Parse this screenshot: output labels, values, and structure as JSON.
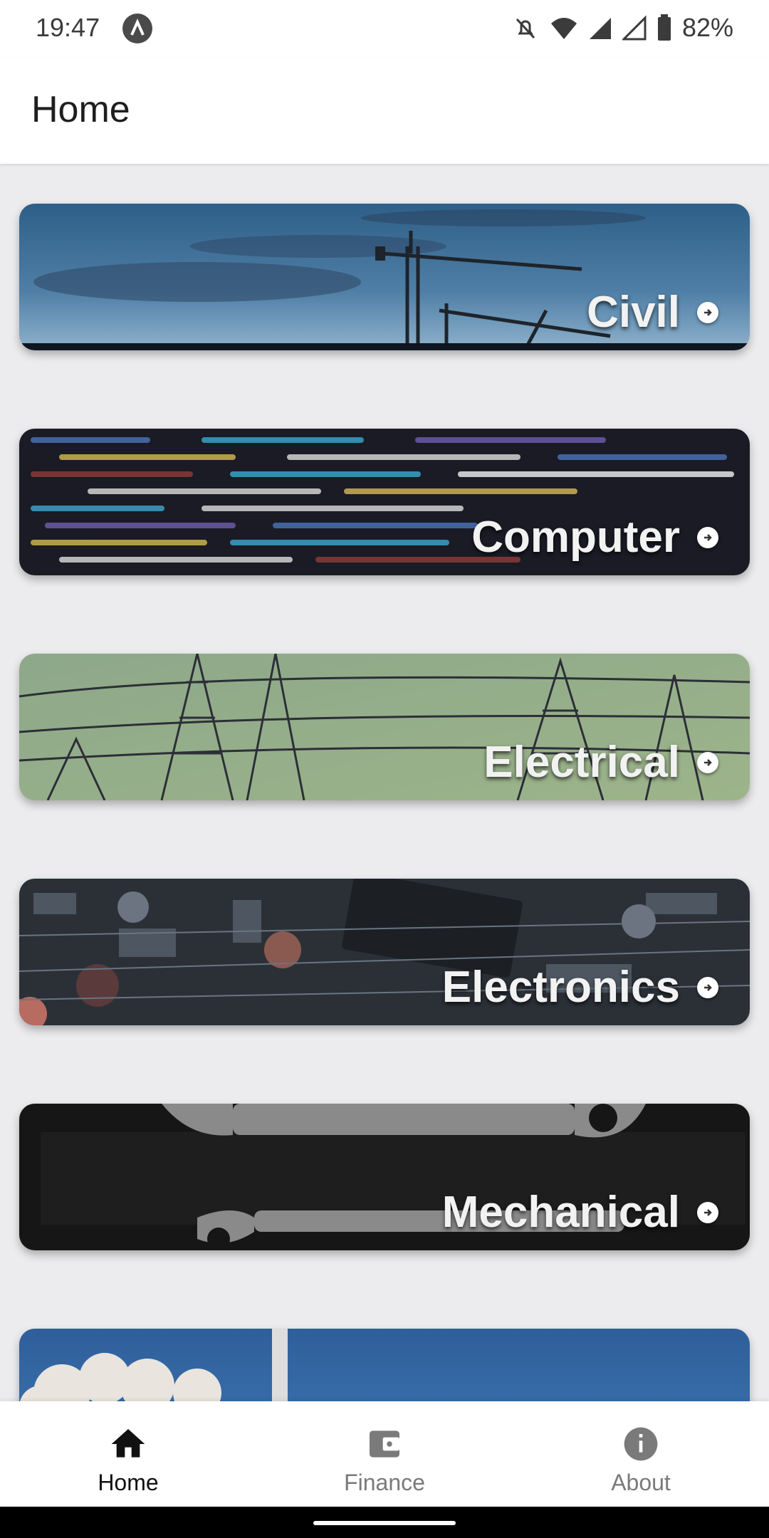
{
  "status_bar": {
    "time": "19:47",
    "battery": "82%"
  },
  "app_bar": {
    "title": "Home"
  },
  "cards": [
    {
      "label": "Civil"
    },
    {
      "label": "Computer"
    },
    {
      "label": "Electrical"
    },
    {
      "label": "Electronics"
    },
    {
      "label": "Mechanical"
    }
  ],
  "bottom_nav": {
    "home": "Home",
    "finance": "Finance",
    "about": "About",
    "active": "Home"
  },
  "colors": {
    "accent": "#111111",
    "inactive": "#7a7a7a",
    "background": "#ececee"
  },
  "icons": [
    "home-icon",
    "finance-icon",
    "about-icon",
    "arrow-circle-right-icon"
  ]
}
